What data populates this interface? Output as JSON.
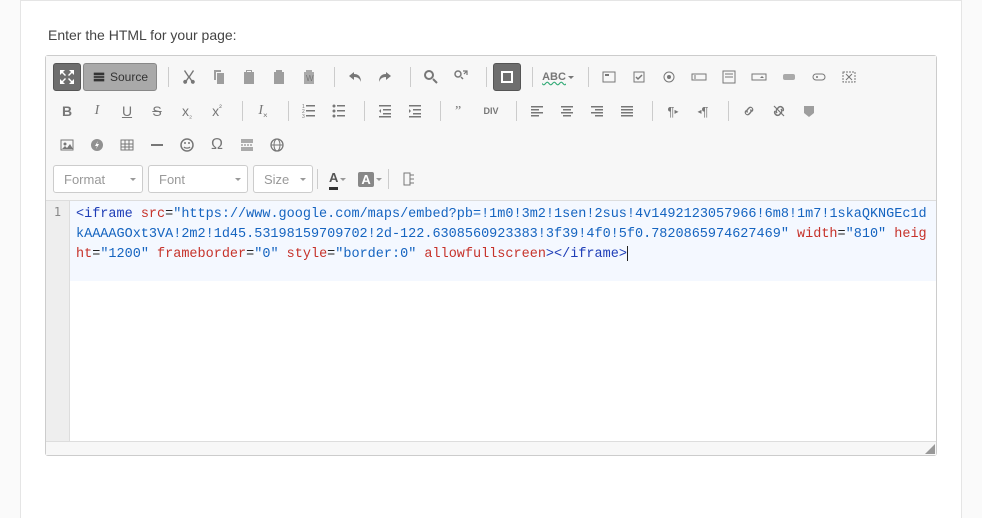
{
  "label": "Enter the HTML for your page:",
  "toolbar": {
    "source_label": "Source",
    "format": "Format",
    "font": "Font",
    "size": "Size",
    "textcolor": "A",
    "bgcolor": "A"
  },
  "gutter": {
    "line1": "1"
  },
  "code": {
    "t_open": "<iframe",
    "a_src": " src",
    "eq": "=",
    "v_src": "\"https://www.google.com/maps/embed?pb=!1m0!3m2!1sen!2sus!4v1492123057966!6m8!1m7!1skaQKNGEc1dkAAAAGOxt3VA!2m2!1d45.53198159709702!2d-122.6308560923383!3f39!4f0!5f0.7820865974627469\"",
    "a_width": " width",
    "v_width": "\"810\"",
    "a_height": " height",
    "v_height": "\"1200\"",
    "a_fb": " frameborder",
    "v_fb": "\"0\"",
    "a_style": " style",
    "v_style": "\"border:0\"",
    "a_afs": " allowfullscreen",
    "t_close": "></iframe>"
  }
}
